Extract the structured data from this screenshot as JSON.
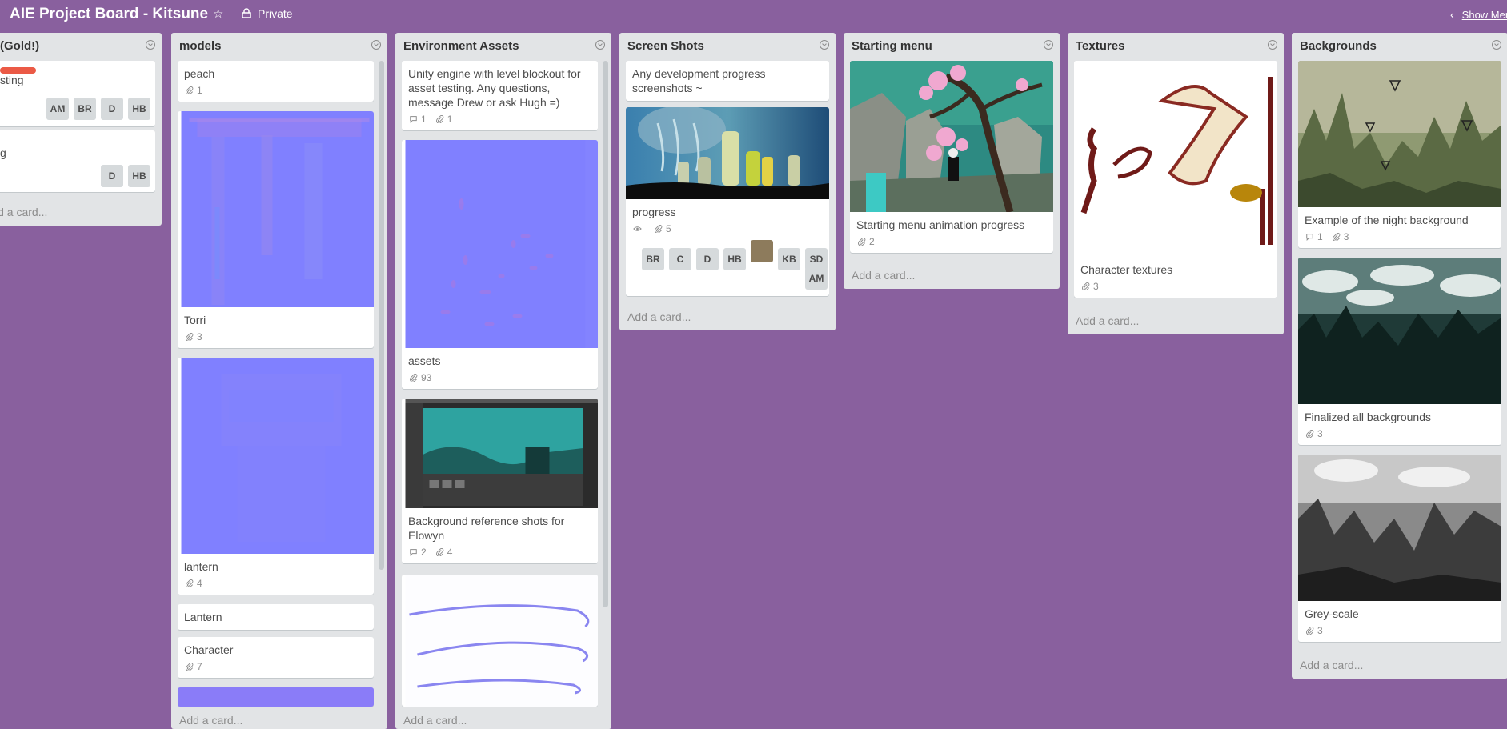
{
  "board": {
    "title": "AIE Project Board - Kitsune",
    "visibility": "Private",
    "show_menu": "Show Menu",
    "star_icon": "star-icon"
  },
  "lists": [
    {
      "title": "(Gold!)",
      "add_card": "Add a card...",
      "cards": [
        {
          "label_color": "#eb5a46",
          "title": "sting",
          "members": [
            "AM",
            "BR",
            "D",
            "HB"
          ]
        },
        {
          "title": "g",
          "members": [
            "D",
            "HB"
          ]
        }
      ]
    },
    {
      "title": "models",
      "add_card": "Add a card...",
      "cards": [
        {
          "title": "peach",
          "attachments": "1"
        },
        {
          "title": "Torri",
          "attachments": "3"
        },
        {
          "title": "lantern",
          "attachments": "4"
        },
        {
          "title": "Lantern"
        },
        {
          "title": "Character",
          "attachments": "7"
        }
      ]
    },
    {
      "title": "Environment Assets",
      "add_card": "Add a card...",
      "cards": [
        {
          "title": "Unity engine with level blockout for asset testing. Any questions, message Drew or ask Hugh =)",
          "comments": "1",
          "attachments": "1"
        },
        {
          "title": "assets",
          "attachments": "93"
        },
        {
          "title": "Background reference shots for Elowyn",
          "comments": "2",
          "attachments": "4"
        }
      ]
    },
    {
      "title": "Screen Shots",
      "add_card": "Add a card...",
      "cards": [
        {
          "title": "Any development progress screenshots ~"
        },
        {
          "title": "progress",
          "attachments": "5",
          "members": [
            "BR",
            "C",
            "D",
            "HB",
            "KB",
            "SD",
            "AM"
          ]
        }
      ]
    },
    {
      "title": "Starting menu",
      "add_card": "Add a card...",
      "cards": [
        {
          "title": "Starting menu animation progress",
          "attachments": "2"
        }
      ]
    },
    {
      "title": "Textures",
      "add_card": "Add a card...",
      "cards": [
        {
          "title": "Character textures",
          "attachments": "3"
        }
      ]
    },
    {
      "title": "Backgrounds",
      "add_card": "Add a card...",
      "cards": [
        {
          "title": "Example of the night background",
          "comments": "1",
          "attachments": "3"
        },
        {
          "title": "Finalized all backgrounds",
          "attachments": "3"
        },
        {
          "title": "Grey-scale",
          "attachments": "3"
        }
      ]
    }
  ],
  "colors": {
    "board_bg": "#89609e",
    "list_bg": "#e2e4e6",
    "normal_map": "#8080ff",
    "label_red": "#eb5a46"
  }
}
